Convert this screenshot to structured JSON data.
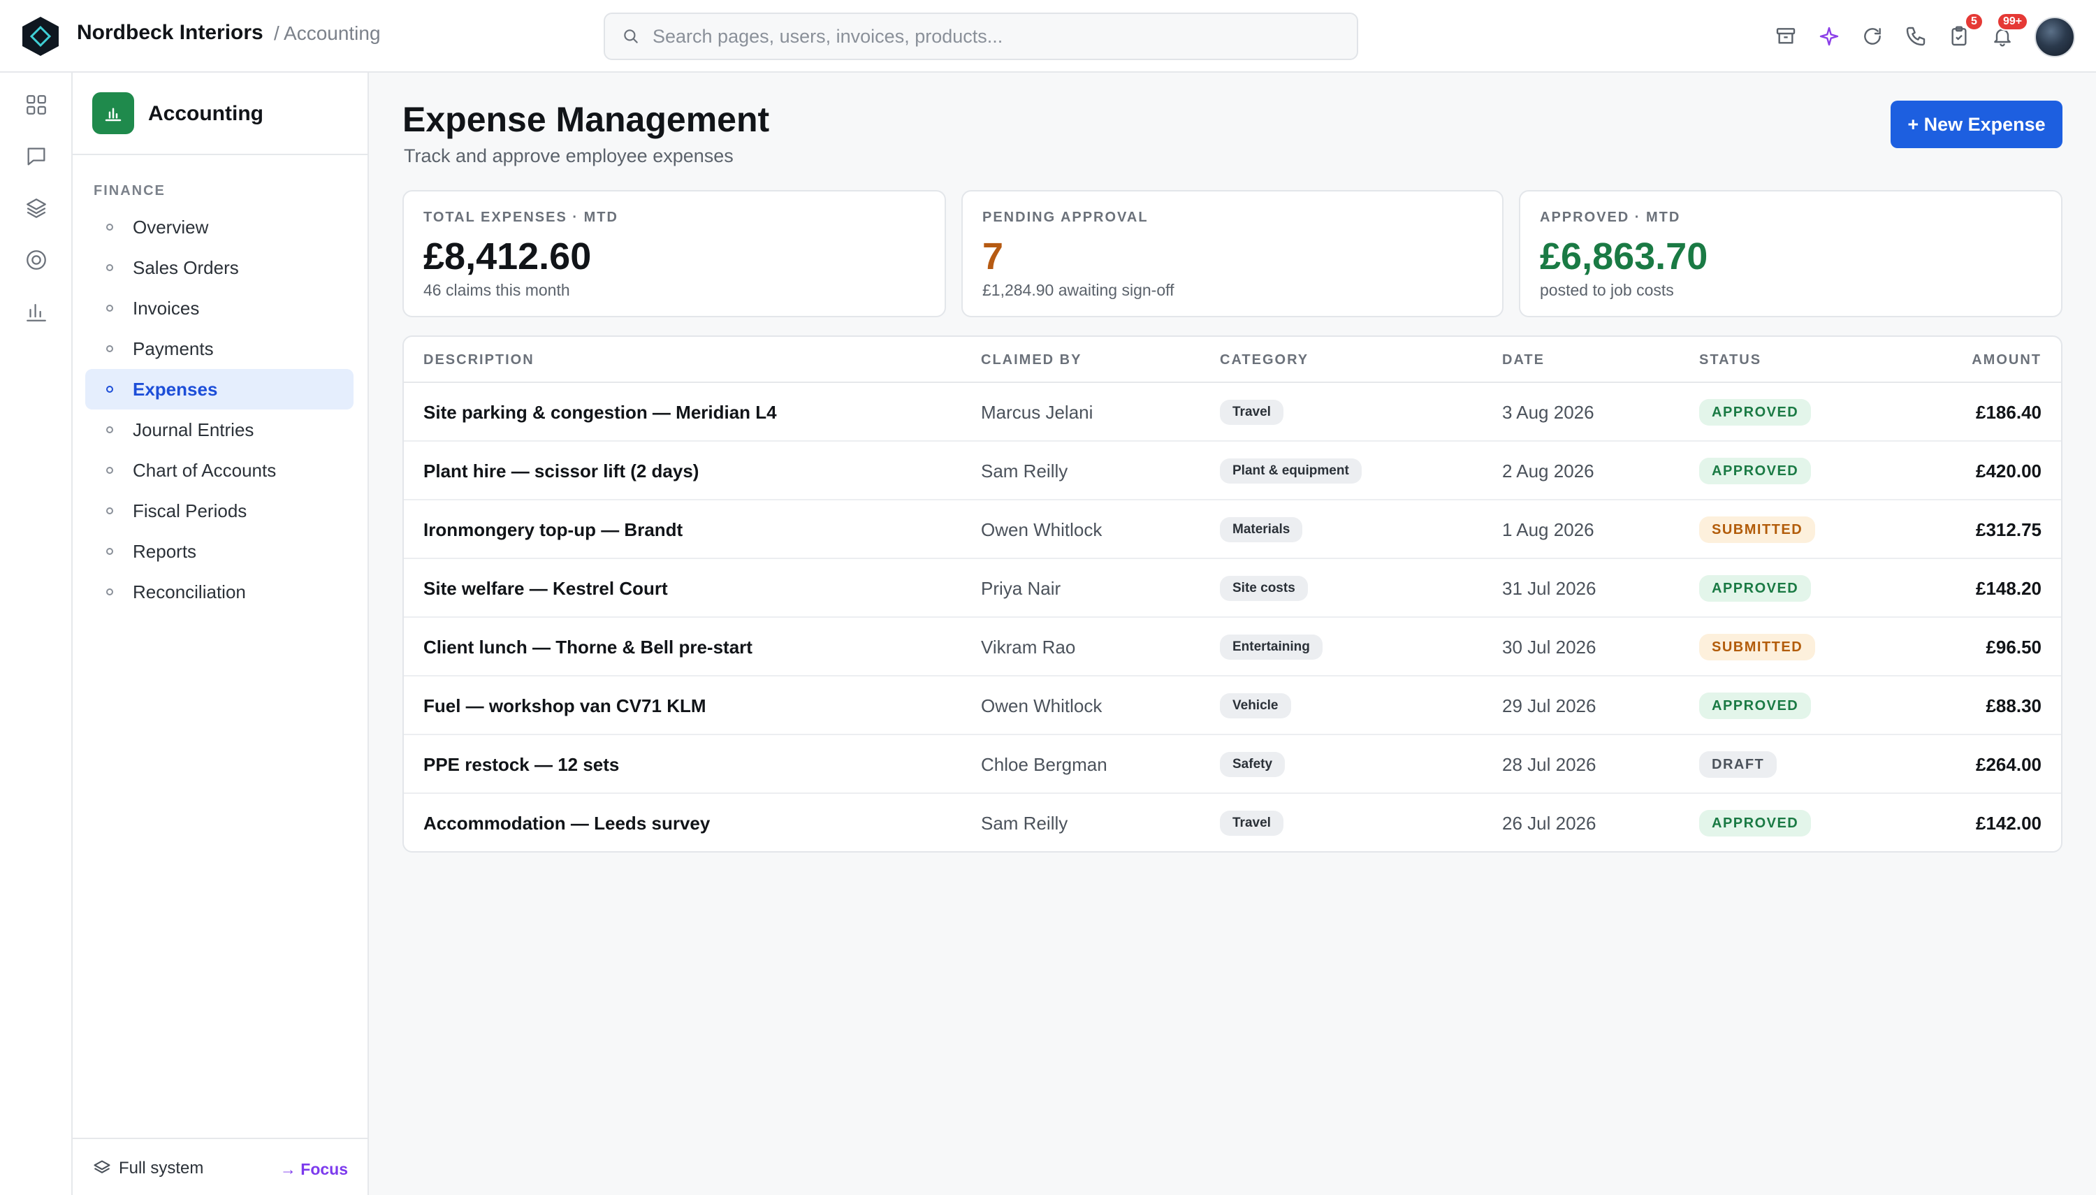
{
  "app": {
    "company": "Nordbeck Interiors",
    "breadcrumb": "/ Accounting"
  },
  "search": {
    "placeholder": "Search pages, users, invoices, products..."
  },
  "topbar": {
    "icons": [
      "archive-icon",
      "sparkle-icon",
      "refresh-icon",
      "phone-icon",
      "clipboard-check-icon",
      "bell-icon"
    ],
    "tasks_badge": "5",
    "notifications_badge": "99+"
  },
  "rail": {
    "icons": [
      "apps-grid-icon",
      "chat-icon",
      "layers-icon",
      "target-icon",
      "bar-chart-icon"
    ]
  },
  "sidebar": {
    "module_title": "Accounting",
    "section_label": "FINANCE",
    "items": [
      {
        "label": "Overview"
      },
      {
        "label": "Sales Orders"
      },
      {
        "label": "Invoices"
      },
      {
        "label": "Payments"
      },
      {
        "label": "Expenses",
        "active": true
      },
      {
        "label": "Journal Entries"
      },
      {
        "label": "Chart of Accounts"
      },
      {
        "label": "Fiscal Periods"
      },
      {
        "label": "Reports"
      },
      {
        "label": "Reconciliation"
      }
    ],
    "footer_left": "Full system",
    "footer_right": "→ Focus"
  },
  "page": {
    "title": "Expense Management",
    "subtitle": "Track and approve employee expenses",
    "new_button": "+ New Expense"
  },
  "stats": [
    {
      "label": "TOTAL EXPENSES · MTD",
      "value": "£8,412.60",
      "sub": "46 claims this month",
      "color": "#111418"
    },
    {
      "label": "PENDING APPROVAL",
      "value": "7",
      "sub": "£1,284.90 awaiting sign-off",
      "color": "#b65a12"
    },
    {
      "label": "APPROVED · MTD",
      "value": "£6,863.70",
      "sub": "posted to job costs",
      "color": "#1a7a44"
    }
  ],
  "table": {
    "headers": {
      "description": "DESCRIPTION",
      "claimed_by": "CLAIMED BY",
      "category": "CATEGORY",
      "date": "DATE",
      "status": "STATUS",
      "amount": "AMOUNT"
    },
    "rows": [
      {
        "description": "Site parking & congestion — Meridian L4",
        "claimed_by": "Marcus Jelani",
        "category": "Travel",
        "date": "3 Aug 2026",
        "status": "APPROVED",
        "amount": "£186.40"
      },
      {
        "description": "Plant hire — scissor lift (2 days)",
        "claimed_by": "Sam Reilly",
        "category": "Plant & equipment",
        "date": "2 Aug 2026",
        "status": "APPROVED",
        "amount": "£420.00"
      },
      {
        "description": "Ironmongery top-up — Brandt",
        "claimed_by": "Owen Whitlock",
        "category": "Materials",
        "date": "1 Aug 2026",
        "status": "SUBMITTED",
        "amount": "£312.75"
      },
      {
        "description": "Site welfare — Kestrel Court",
        "claimed_by": "Priya Nair",
        "category": "Site costs",
        "date": "31 Jul 2026",
        "status": "APPROVED",
        "amount": "£148.20"
      },
      {
        "description": "Client lunch — Thorne & Bell pre-start",
        "claimed_by": "Vikram Rao",
        "category": "Entertaining",
        "date": "30 Jul 2026",
        "status": "SUBMITTED",
        "amount": "£96.50"
      },
      {
        "description": "Fuel — workshop van CV71 KLM",
        "claimed_by": "Owen Whitlock",
        "category": "Vehicle",
        "date": "29 Jul 2026",
        "status": "APPROVED",
        "amount": "£88.30"
      },
      {
        "description": "PPE restock — 12 sets",
        "claimed_by": "Chloe Bergman",
        "category": "Safety",
        "date": "28 Jul 2026",
        "status": "DRAFT",
        "amount": "£264.00"
      },
      {
        "description": "Accommodation — Leeds survey",
        "claimed_by": "Sam Reilly",
        "category": "Travel",
        "date": "26 Jul 2026",
        "status": "APPROVED",
        "amount": "£142.00"
      }
    ]
  }
}
